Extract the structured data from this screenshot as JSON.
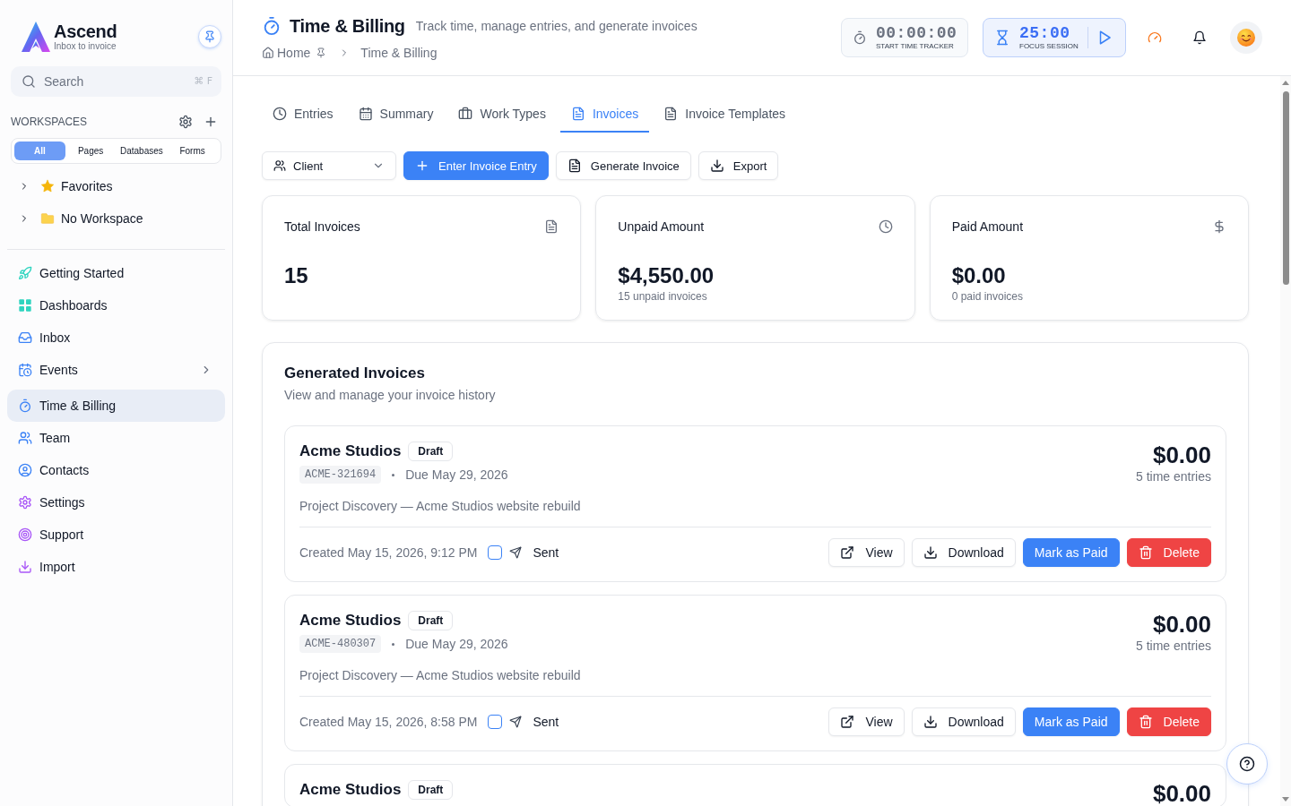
{
  "sidebar": {
    "brand": {
      "name": "Ascend",
      "tagline": "Inbox to invoice"
    },
    "search": {
      "placeholder": "Search",
      "shortcut": "⌘ F"
    },
    "workspaces": {
      "label": "WORKSPACES",
      "filters": [
        {
          "label": "All",
          "selected": true
        },
        {
          "label": "Pages",
          "selected": false
        },
        {
          "label": "Databases",
          "selected": false
        },
        {
          "label": "Forms",
          "selected": false
        }
      ],
      "tree": [
        {
          "label": "Favorites",
          "kind": "favorites",
          "expanded": false
        },
        {
          "label": "No Workspace",
          "kind": "folder",
          "expanded": false
        }
      ]
    },
    "nav": [
      {
        "label": "Getting Started",
        "selected": false,
        "expandable": false
      },
      {
        "label": "Dashboards",
        "selected": false,
        "expandable": false
      },
      {
        "label": "Inbox",
        "selected": false,
        "expandable": false
      },
      {
        "label": "Events",
        "selected": false,
        "expandable": true
      },
      {
        "label": "Time & Billing",
        "selected": true,
        "expandable": false
      },
      {
        "label": "Team",
        "selected": false,
        "expandable": false
      },
      {
        "label": "Contacts",
        "selected": false,
        "expandable": false
      },
      {
        "label": "Settings",
        "selected": false,
        "expandable": false
      },
      {
        "label": "Support",
        "selected": false,
        "expandable": false
      },
      {
        "label": "Import",
        "selected": false,
        "expandable": false
      }
    ]
  },
  "header": {
    "title": "Time & Billing",
    "subtitle": "Track time, manage entries, and generate invoices",
    "breadcrumb": [
      "Home",
      "Time & Billing"
    ],
    "timer": {
      "display": "00:00:00",
      "label": "START TIME TRACKER"
    },
    "focus": {
      "display": "25:00",
      "label": "FOCUS SESSION"
    }
  },
  "tabs": [
    {
      "label": "Entries",
      "selected": false
    },
    {
      "label": "Summary",
      "selected": false
    },
    {
      "label": "Work Types",
      "selected": false
    },
    {
      "label": "Invoices",
      "selected": true
    },
    {
      "label": "Invoice Templates",
      "selected": false
    }
  ],
  "toolbar": {
    "client_filter": "Client",
    "buttons": [
      {
        "label": "Enter Invoice Entry",
        "kind": "primary"
      },
      {
        "label": "Generate Invoice",
        "kind": "document"
      },
      {
        "label": "Export",
        "kind": "export"
      }
    ]
  },
  "stats": [
    {
      "title": "Total Invoices",
      "value": "15"
    },
    {
      "title": "Unpaid Amount",
      "value": "$4,550.00",
      "note": "15 unpaid invoices"
    },
    {
      "title": "Paid Amount",
      "value": "$0.00",
      "note": "0 paid invoices"
    }
  ],
  "invoices_panel": {
    "title": "Generated Invoices",
    "subtitle": "View and manage your invoice history",
    "invoices": [
      {
        "client": "Acme Studios",
        "status": "Draft",
        "number": "ACME-321694",
        "due": "Due May 29, 2026",
        "description": "Project Discovery — Acme Studios website rebuild",
        "created": "Created May 15, 2026, 9:12 PM",
        "sent": false,
        "sent_label": "Sent",
        "amount": "$0.00",
        "entries": "5 time entries",
        "actions": [
          {
            "label": "View",
            "kind": "view"
          },
          {
            "label": "Download",
            "kind": "download"
          },
          {
            "label": "Mark as Paid",
            "kind": "primary"
          },
          {
            "label": "Delete",
            "kind": "danger"
          }
        ]
      },
      {
        "client": "Acme Studios",
        "status": "Draft",
        "number": "ACME-480307",
        "due": "Due May 29, 2026",
        "description": "Project Discovery — Acme Studios website rebuild",
        "created": "Created May 15, 2026, 8:58 PM",
        "sent": false,
        "sent_label": "Sent",
        "amount": "$0.00",
        "entries": "5 time entries",
        "actions": [
          {
            "label": "View",
            "kind": "view"
          },
          {
            "label": "Download",
            "kind": "download"
          },
          {
            "label": "Mark as Paid",
            "kind": "primary"
          },
          {
            "label": "Delete",
            "kind": "danger"
          }
        ]
      },
      {
        "client": "Acme Studios",
        "status": "Draft",
        "amount": "$0.00"
      }
    ]
  }
}
